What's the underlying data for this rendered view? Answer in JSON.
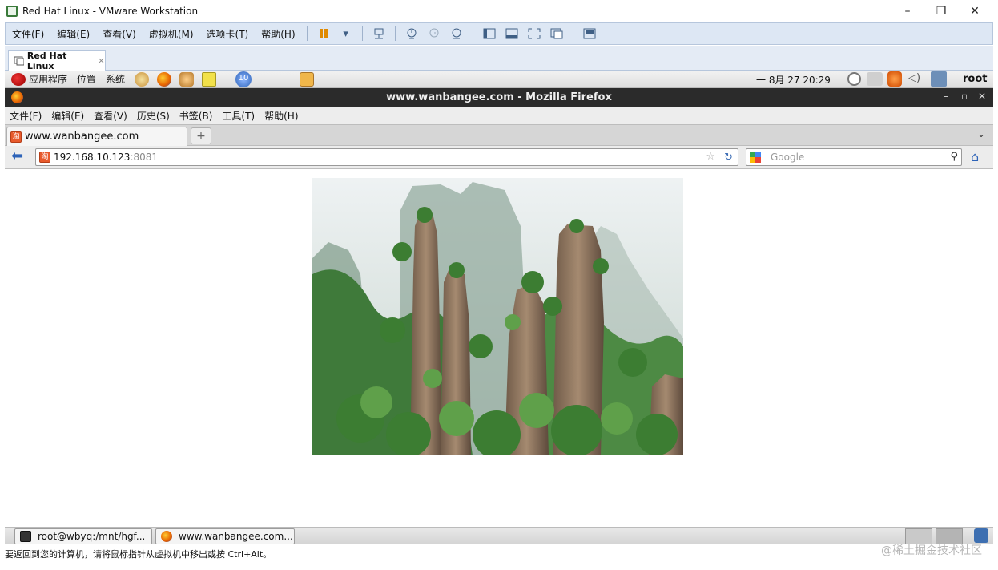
{
  "vmware": {
    "title": "Red Hat Linux - VMware Workstation",
    "menu": [
      "文件(F)",
      "编辑(E)",
      "查看(V)",
      "虚拟机(M)",
      "选项卡(T)",
      "帮助(H)"
    ],
    "tab_label": "Red Hat Linux",
    "tab_close": "×",
    "status_text": "要返回到您的计算机，请将鼠标指针从虚拟机中移出或按 Ctrl+Alt。",
    "window_controls": {
      "minimize": "–",
      "restore": "❐",
      "close": "✕"
    }
  },
  "gnome_panel": {
    "menus": [
      "应用程序",
      "位置",
      "系统"
    ],
    "workspace_badge": "10",
    "clock": "一 8月 27 20:29",
    "user": "root"
  },
  "firefox": {
    "window_title": "www.wanbangee.com - Mozilla Firefox",
    "window_controls": {
      "minimize": "–",
      "maximize": "▫",
      "close": "✕"
    },
    "menu": [
      "文件(F)",
      "编辑(E)",
      "查看(V)",
      "历史(S)",
      "书签(B)",
      "工具(T)",
      "帮助(H)"
    ],
    "tab_title": "www.wanbangee.com",
    "favicon_glyph": "淘",
    "new_tab": "+",
    "tab_list": "⌄",
    "url_host": "192.168.10.123",
    "url_port": ":8081",
    "search_placeholder": "Google",
    "star": "☆",
    "reload": "↻",
    "find": "⚲",
    "back": "⬅",
    "home": "⌂"
  },
  "taskbar": {
    "items": [
      "root@wbyq:/mnt/hgf...",
      "www.wanbangee.com..."
    ]
  },
  "watermark": "@稀土掘金技术社区",
  "colors": {
    "vm_menubar": "#dde7f4",
    "firefox_titlebar": "#2b2b2b",
    "gnome_panel": "#e6e6e6",
    "accent_blue": "#2d63b8"
  },
  "icons": [
    "redhat-icon",
    "firefox-icon",
    "mail-icon",
    "notes-icon",
    "update-icon",
    "folder-icon",
    "clock-icon",
    "network-icon",
    "alert-icon",
    "volume-icon",
    "computer-icon"
  ]
}
